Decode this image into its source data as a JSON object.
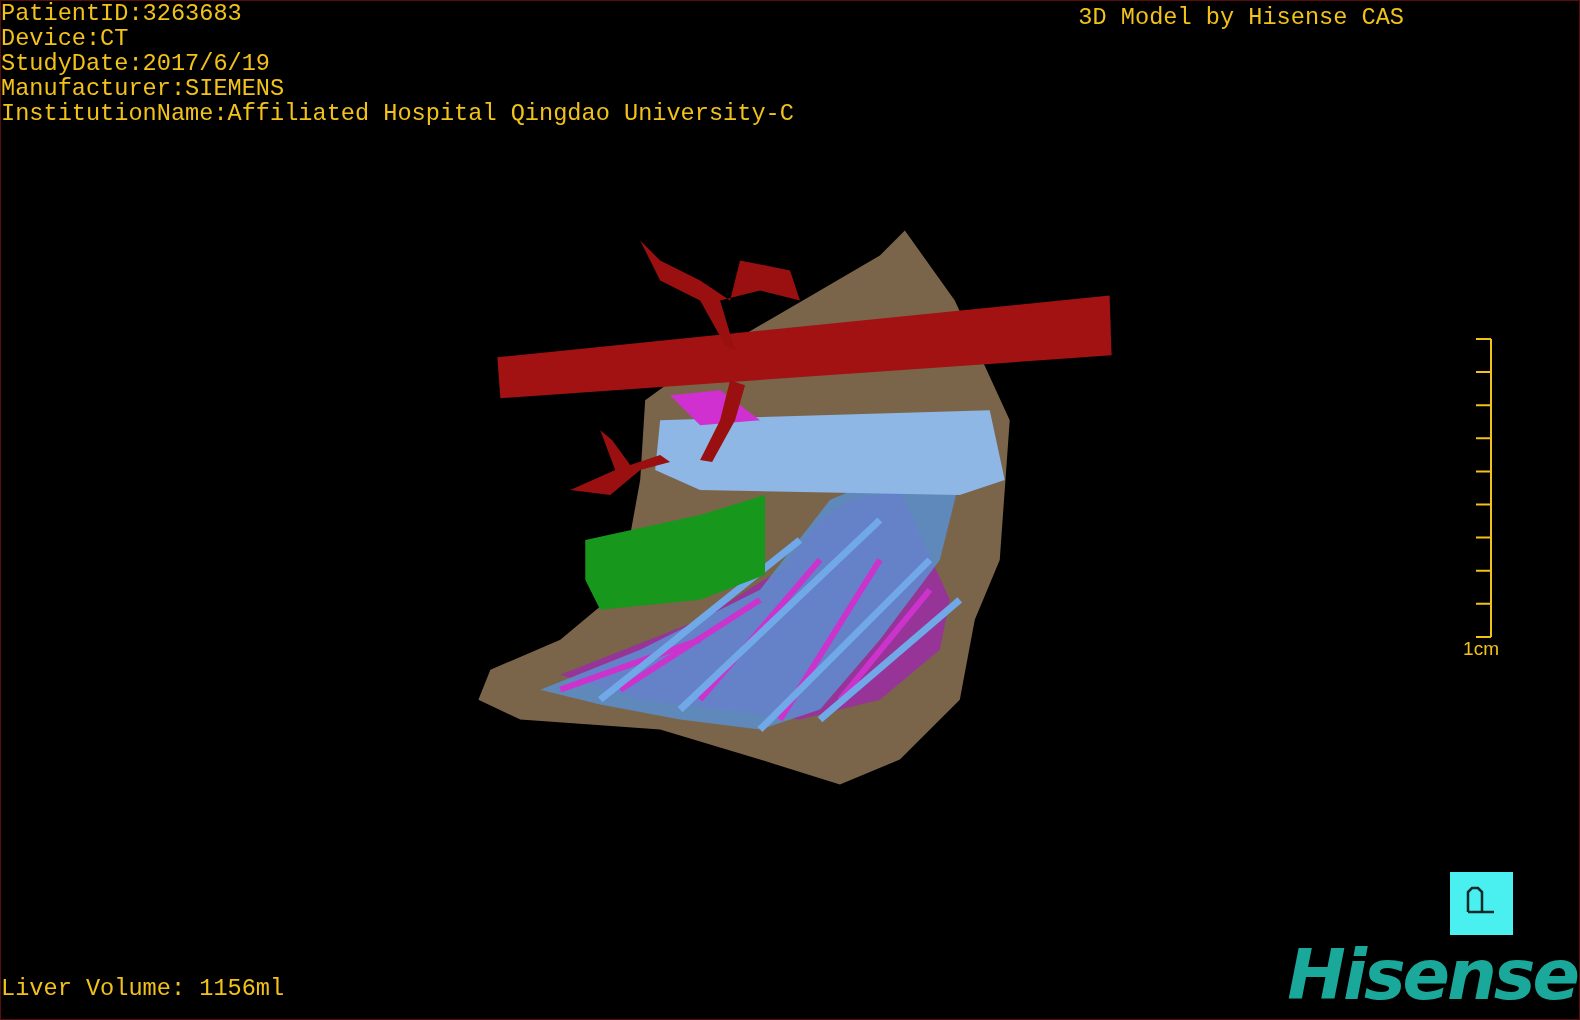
{
  "patient_info": [
    "PatientID:3263683",
    "Device:CT",
    "StudyDate:2017/6/19",
    "Manufacturer:SIEMENS",
    "InstitutionName:Affiliated Hospital Qingdao University-C"
  ],
  "caption": "3D Model by Hisense CAS",
  "scale_bar": {
    "label": "1cm"
  },
  "liver_volume": "Liver Volume: 1156ml",
  "logo": "Hisense"
}
